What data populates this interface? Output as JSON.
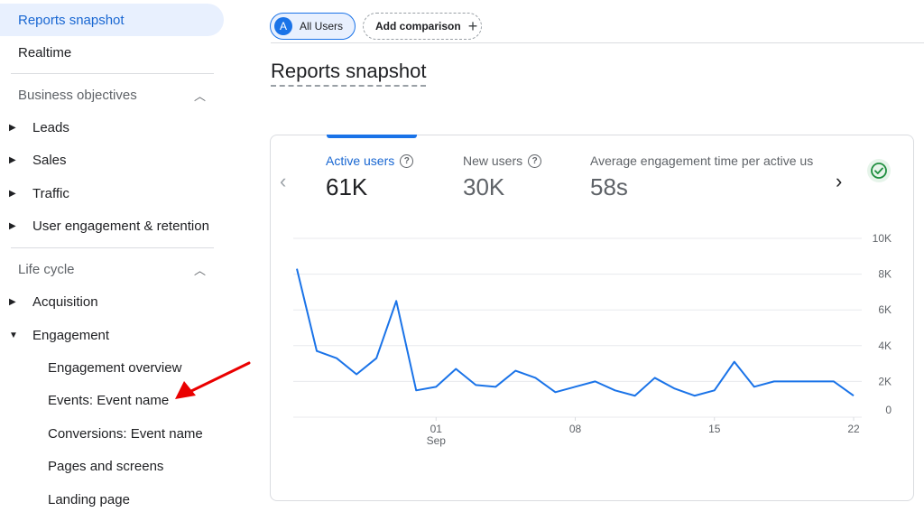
{
  "sidebar": {
    "reports_snapshot": "Reports snapshot",
    "realtime": "Realtime",
    "business_objectives": "Business objectives",
    "leads": "Leads",
    "sales": "Sales",
    "traffic": "Traffic",
    "user_engagement": "User engagement & retention",
    "life_cycle": "Life cycle",
    "acquisition": "Acquisition",
    "engagement": "Engagement",
    "engagement_overview": "Engagement overview",
    "events_event_name": "Events: Event name",
    "conversions_event_name": "Conversions: Event name",
    "pages_and_screens": "Pages and screens",
    "landing_page": "Landing page"
  },
  "topbar": {
    "avatar_letter": "A",
    "all_users": "All Users",
    "add_comparison": "Add comparison",
    "plus": "+"
  },
  "page_title": "Reports snapshot",
  "metrics": [
    {
      "label": "Active users",
      "value": "61K"
    },
    {
      "label": "New users",
      "value": "30K"
    },
    {
      "label": "Average engagement time per active us",
      "value": "58s"
    }
  ],
  "colors": {
    "accent": "#1a73e8",
    "active_bg": "#e8f0fe",
    "success": "#1e8e3e",
    "annotation_arrow": "#ea0000"
  },
  "icons": {
    "help": "?",
    "left_arrow": "‹",
    "right_arrow": "›",
    "check": "check-circle-icon"
  },
  "chart_data": {
    "type": "line",
    "x_tick_labels": [
      "01",
      "08",
      "15",
      "22"
    ],
    "x_tick_sub": "Sep",
    "y_tick_labels": [
      "10K",
      "8K",
      "6K",
      "4K",
      "2K",
      "0"
    ],
    "ylim": [
      0,
      10000
    ],
    "grid": true,
    "series": [
      {
        "x": [
          "Aug 25",
          "Aug 26",
          "Aug 27",
          "Aug 28",
          "Aug 29",
          "Aug 30",
          "Aug 31",
          "Sep 1",
          "Sep 2",
          "Sep 3",
          "Sep 4",
          "Sep 5",
          "Sep 6",
          "Sep 7",
          "Sep 8",
          "Sep 9",
          "Sep 10",
          "Sep 11",
          "Sep 12",
          "Sep 13",
          "Sep 14",
          "Sep 15",
          "Sep 16",
          "Sep 17",
          "Sep 18",
          "Sep 19",
          "Sep 20",
          "Sep 21",
          "Sep 22"
        ],
        "values": [
          8300,
          3700,
          3300,
          2400,
          3300,
          6500,
          1500,
          1700,
          2700,
          1800,
          1700,
          2600,
          2200,
          1400,
          1700,
          2000,
          1500,
          1200,
          2200,
          1600,
          1200,
          1500,
          3100,
          1700,
          2000,
          2000,
          2000,
          2000,
          1200
        ]
      }
    ]
  }
}
